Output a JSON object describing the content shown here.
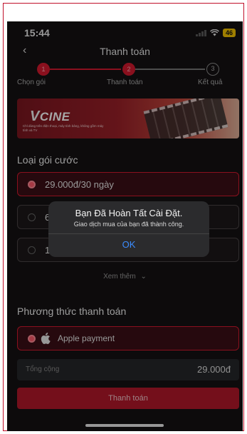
{
  "status_bar": {
    "time": "15:44",
    "battery": "46"
  },
  "header": {
    "back_icon": "chevron-left",
    "title": "Thanh toán"
  },
  "stepper": {
    "steps": [
      {
        "number": "1",
        "label": "Chọn gói",
        "state": "done"
      },
      {
        "number": "2",
        "label": "Thanh toán",
        "state": "active"
      },
      {
        "number": "3",
        "label": "Kết quả",
        "state": "todo"
      }
    ]
  },
  "banner": {
    "logo_text": "CINE",
    "description": "Chỉ dùng trên điện thoại, máy tính bảng, không gồm máy tính và TV"
  },
  "plans": {
    "title": "Loại gói cước",
    "options": [
      {
        "label": "29.000đ/30 ngày",
        "selected": true
      },
      {
        "label": "6",
        "selected": false
      },
      {
        "label": "1",
        "selected": false
      }
    ],
    "see_more": "Xem thêm"
  },
  "payment": {
    "title": "Phương thức thanh toán",
    "method": "Apple payment",
    "method_icon": "apple-icon"
  },
  "total": {
    "label": "Tổng cộng",
    "value": "29.000đ"
  },
  "pay_button": "Thanh toán",
  "alert": {
    "title": "Bạn Đã Hoàn Tất Cài Đặt.",
    "message": "Giao dịch mua của bạn đã thành công.",
    "ok": "OK"
  },
  "colors": {
    "accent": "#d41a2e",
    "background": "#151213",
    "link": "#3b8cff"
  }
}
